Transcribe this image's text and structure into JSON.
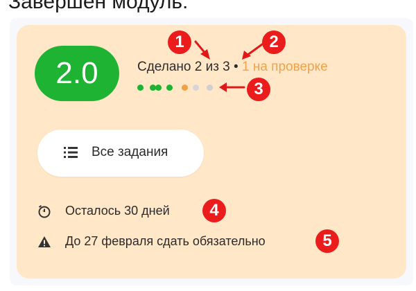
{
  "page": {
    "heading": "Завершен модуль:"
  },
  "module_card": {
    "grade": "2.0",
    "progress": {
      "done_text": "Сделано 2 из 3",
      "separator": "•",
      "review_text": "1 на проверке"
    },
    "progress_dots": [
      {
        "status": "done",
        "color": "#1fb334"
      },
      {
        "status": "done",
        "color": "#1fb334"
      },
      {
        "status": "done",
        "color": "#1fb334"
      },
      {
        "status": "done",
        "color": "#1fb334"
      },
      {
        "status": "review",
        "color": "#f0a24a"
      },
      {
        "status": "pending",
        "color": "#d6d6d6"
      },
      {
        "status": "pending",
        "color": "#cfcfcf"
      }
    ],
    "all_tasks_button": {
      "icon": "list-icon",
      "label": "Все задания"
    },
    "remaining": {
      "icon": "timer-icon",
      "text": "Осталось 30 дней"
    },
    "deadline": {
      "icon": "warning-icon",
      "text": "До 27 февраля сдать обязательно"
    }
  },
  "annotations": [
    {
      "number": "1"
    },
    {
      "number": "2"
    },
    {
      "number": "3"
    },
    {
      "number": "4"
    },
    {
      "number": "5"
    }
  ],
  "colors": {
    "card_bg": "#ffe7c7",
    "grade_bg": "#1fb334",
    "review": "#f0a24a",
    "badge": "#ea1c1c"
  }
}
